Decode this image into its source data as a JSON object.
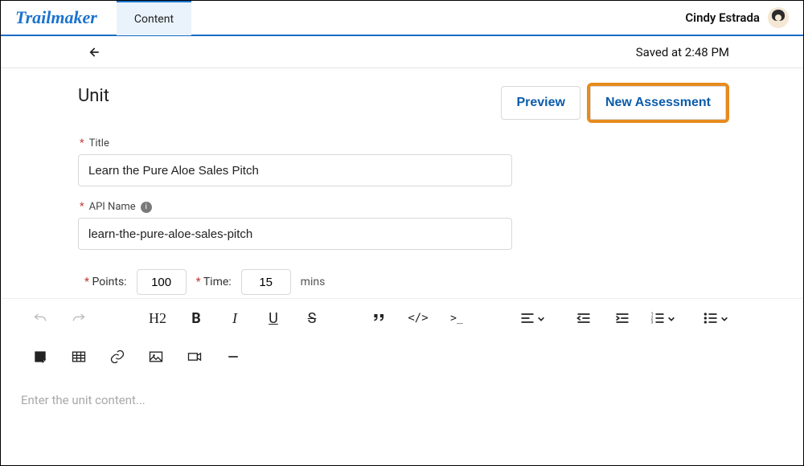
{
  "app": {
    "logo_a": "Trail",
    "logo_b": "maker",
    "tab_label": "Content",
    "user_name": "Cindy Estrada"
  },
  "secbar": {
    "saved_text": "Saved at 2:48 PM"
  },
  "header": {
    "title": "Unit",
    "preview_btn": "Preview",
    "assessment_btn": "New Assessment"
  },
  "form": {
    "title_label": "Title",
    "title_value": "Learn the Pure Aloe Sales Pitch",
    "api_label": "API Name",
    "api_value": "learn-the-pure-aloe-sales-pitch",
    "points_label": "Points:",
    "points_value": "100",
    "time_label": "Time:",
    "time_value": "15",
    "mins_label": "mins",
    "required_mark": "*"
  },
  "editor": {
    "placeholder": "Enter the unit content...",
    "h2": "H2",
    "bold": "B",
    "italic": "I",
    "underline": "U",
    "strike": "S",
    "code": "</>",
    "prompt": ">_"
  }
}
